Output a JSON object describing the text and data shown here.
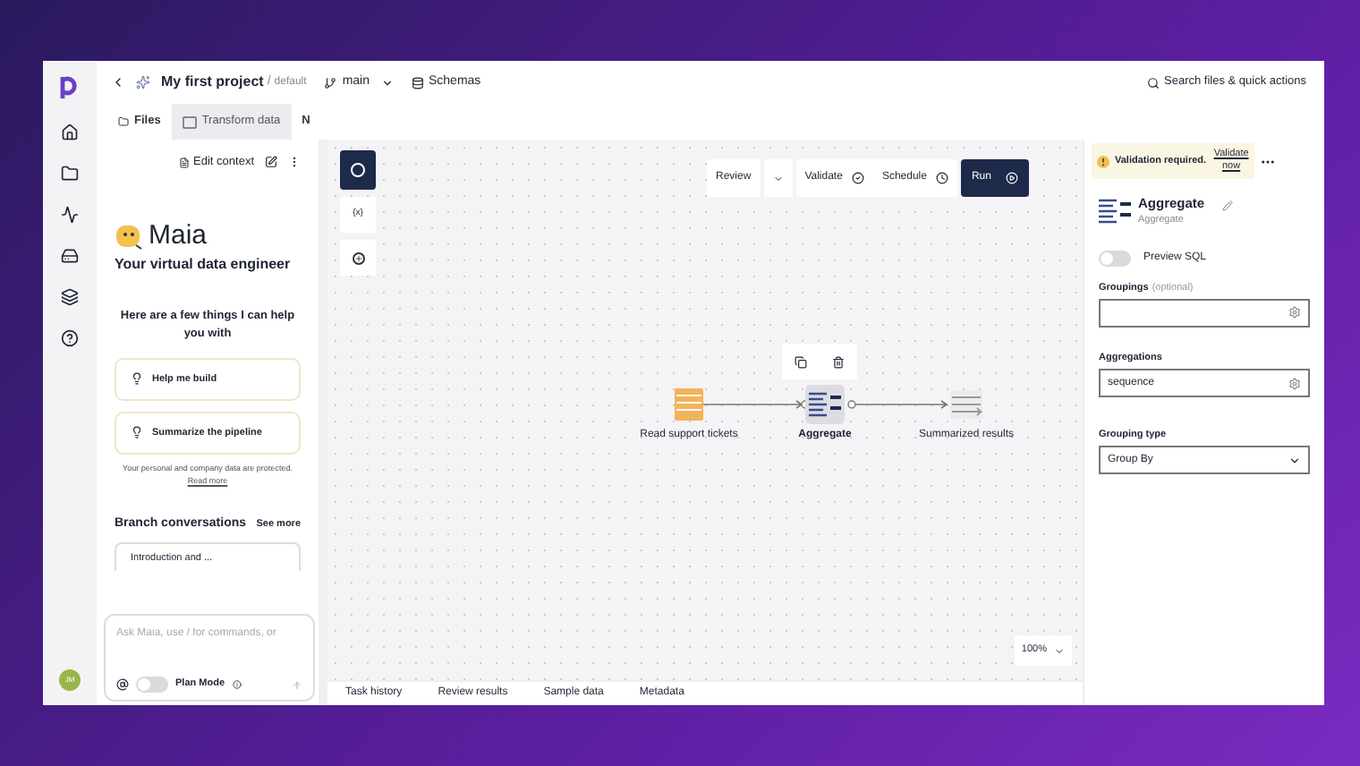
{
  "header": {
    "project": "My first project",
    "separator": "/",
    "environment": "default",
    "branch": "main",
    "schemas": "Schemas",
    "search": "Search files & quick actions"
  },
  "tabs": [
    {
      "label": "Files",
      "selected": false
    },
    {
      "label": "Transform data",
      "selected": true
    },
    {
      "label": "N",
      "selected": false
    }
  ],
  "chat": {
    "edit_context": "Edit context",
    "brand": "Maia",
    "tagline": "Your virtual data engineer",
    "intro": "Here are a few things I can help you with",
    "suggestions": [
      "Help me build",
      "Summarize the pipeline"
    ],
    "privacy": "Your personal and company data are protected.",
    "read_more": "Read more",
    "branch_title": "Branch conversations",
    "see_more": "See more",
    "conversations": [
      "Introduction and ..."
    ],
    "input": {
      "placeholder": "Ask Maia, use / for commands, or"
    },
    "plan_mode": {
      "label": "Plan Mode",
      "on": false
    }
  },
  "user": {
    "initials": "JM"
  },
  "canvas": {
    "toolbar": [
      {
        "label": "Review",
        "kind": "plain"
      },
      {
        "kind": "dropdown"
      },
      {
        "label": "Validate",
        "kind": "validate"
      },
      {
        "label": "Schedule",
        "kind": "schedule"
      },
      {
        "label": "Run",
        "kind": "primary"
      }
    ],
    "side_tools": [
      {
        "kind": "logo"
      },
      {
        "label": "{x}",
        "kind": "text"
      },
      {
        "kind": "add"
      }
    ],
    "nodes": [
      {
        "label": "Read support tickets",
        "kind": "source",
        "selected": false
      },
      {
        "label": "Aggregate",
        "kind": "aggregate",
        "selected": true
      },
      {
        "label": "Summarized results",
        "kind": "output",
        "selected": false
      }
    ],
    "zoom": "100%",
    "bottom_tabs": [
      "Task history",
      "Review results",
      "Sample data",
      "Metadata"
    ]
  },
  "panel": {
    "banner": "Validation required.",
    "banner_link": "Validate now",
    "title": "Aggregate",
    "subtitle": "Aggregate",
    "preview_sql": {
      "label": "Preview SQL",
      "on": false
    },
    "fields": [
      {
        "label": "Groupings",
        "hint": "(optional)",
        "kind": "gear"
      },
      {
        "label": "Aggregations",
        "value": "sequence",
        "kind": "gear"
      },
      {
        "label": "Grouping type",
        "value": "Group By",
        "kind": "select"
      }
    ]
  }
}
